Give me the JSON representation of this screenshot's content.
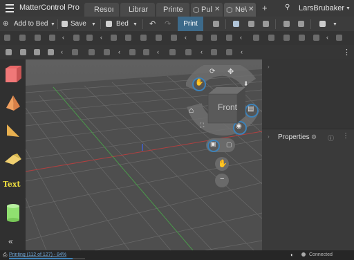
{
  "app": {
    "title": "MatterControl Pro"
  },
  "tabs": [
    {
      "label": "Resoı"
    },
    {
      "label": "Librar"
    },
    {
      "label": "Printe"
    },
    {
      "label": "Pul"
    },
    {
      "label": "Ne\\"
    }
  ],
  "user": {
    "name": "LarsBrubaker"
  },
  "toolbar": {
    "add_to_bed": "Add to Bed",
    "save": "Save",
    "bed": "Bed",
    "print": "Print"
  },
  "library_items": [
    {
      "label": "Text"
    }
  ],
  "view_cube": {
    "face_label": "Front"
  },
  "properties": {
    "title": "Properties"
  },
  "status": {
    "printing": "Printing (112 of 127) - 84%",
    "progress": 0.84,
    "connection": "Connected"
  },
  "colors": {
    "accent": "#3d6a8a",
    "viewport": "#555555",
    "grid_red": "#b04040",
    "grid_green": "#4a9a4a",
    "cube": "#5a5a5a"
  }
}
